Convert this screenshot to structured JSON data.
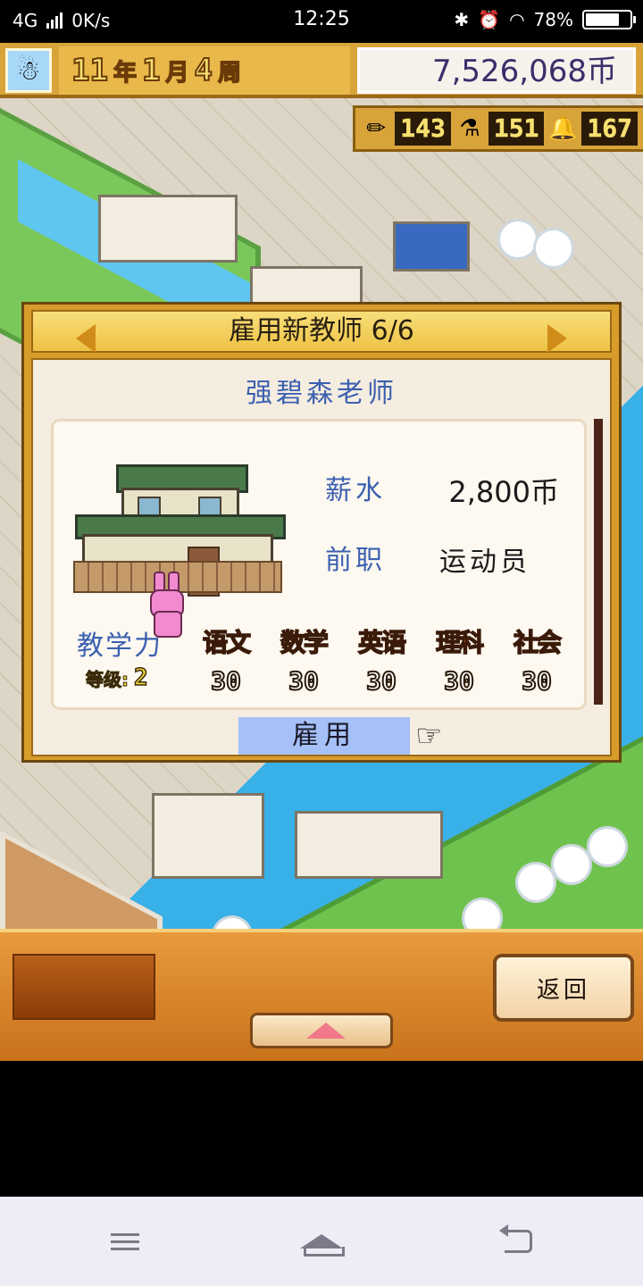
{
  "status_bar": {
    "network": "4G",
    "speed": "0K/s",
    "time": "12:25",
    "battery_percent": "78%",
    "battery_level": 0.78
  },
  "hud": {
    "year": "11",
    "year_unit": "年",
    "month": "1",
    "month_unit": "月",
    "week": "4",
    "week_unit": "周",
    "money": "7,526,068币",
    "stats": [
      {
        "icon": "pencil-icon",
        "value": "143"
      },
      {
        "icon": "flask-icon",
        "value": "151"
      },
      {
        "icon": "bell-icon",
        "value": "167"
      }
    ]
  },
  "dialog": {
    "title": "雇用新教师 6/6",
    "teacher_name": "强碧森老师",
    "salary_label": "薪水",
    "salary_value": "2,800币",
    "prev_job_label": "前职",
    "prev_job_value": "运动员",
    "teaching_power_label": "教学力",
    "level_label": "等级:",
    "level_value": "2",
    "subjects": [
      {
        "name": "语文",
        "value": "30"
      },
      {
        "name": "数学",
        "value": "30"
      },
      {
        "name": "英语",
        "value": "30"
      },
      {
        "name": "理科",
        "value": "30"
      },
      {
        "name": "社会",
        "value": "30"
      }
    ],
    "hire_label": "雇用"
  },
  "bottom": {
    "back_label": "返回"
  },
  "colors": {
    "accent_blue": "#3c60b0",
    "hud_gold": "#d8a43a",
    "subject_orange": "#e86818",
    "hire_highlight": "#a6c0f8"
  }
}
